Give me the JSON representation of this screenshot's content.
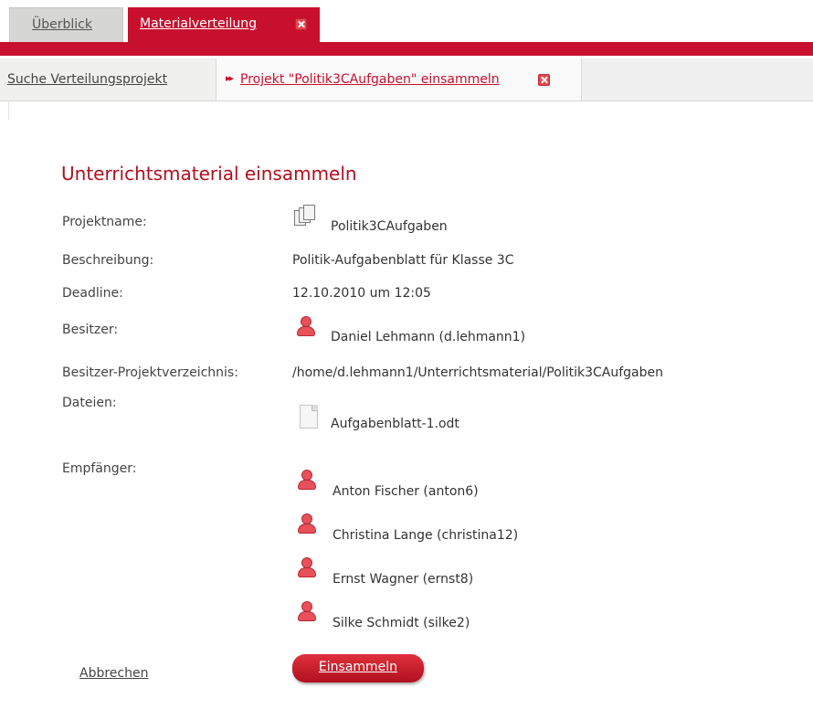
{
  "tabs": {
    "overview": "Überblick",
    "material": "Materialverteilung"
  },
  "breadcrumb": {
    "search": "Suche Verteilungsprojekt",
    "current": "Projekt \"Politik3CAufgaben\" einsammeln"
  },
  "heading": "Unterrichtsmaterial einsammeln",
  "fields": {
    "projektname_label": "Projektname:",
    "projektname_value": "Politik3CAufgaben",
    "beschreibung_label": "Beschreibung:",
    "beschreibung_value": "Politik-Aufgabenblatt für Klasse 3C",
    "deadline_label": "Deadline:",
    "deadline_value": "12.10.2010 um 12:05",
    "besitzer_label": "Besitzer:",
    "besitzer_value": "Daniel Lehmann (d.lehmann1)",
    "verzeichnis_label": "Besitzer-Projektverzeichnis:",
    "verzeichnis_value": "/home/d.lehmann1/Unterrichtsmaterial/Politik3CAufgaben",
    "dateien_label": "Dateien:",
    "dateien_value": "Aufgabenblatt-1.odt",
    "empfaenger_label": "Empfänger:"
  },
  "recipients": [
    "Anton Fischer (anton6)",
    "Christina Lange (christina12)",
    "Ernst Wagner (ernst8)",
    "Silke Schmidt (silke2)"
  ],
  "actions": {
    "cancel": "Abbrechen",
    "collect": "Einsammeln"
  },
  "colors": {
    "accent": "#c8102e",
    "heading": "#b0101f"
  }
}
